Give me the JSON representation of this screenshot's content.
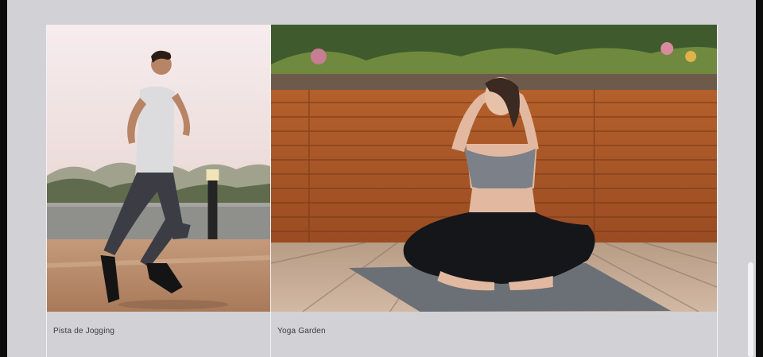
{
  "gallery": {
    "cards": [
      {
        "label": "Pista de Jogging",
        "photo": "jogging-runner-photo"
      },
      {
        "label": "Yoga Garden",
        "photo": "yoga-stretch-photo"
      }
    ]
  },
  "colors": {
    "page_background": "#d2d2d6",
    "window_frame": "#0c0c0c",
    "label_text": "#3a3a40"
  }
}
